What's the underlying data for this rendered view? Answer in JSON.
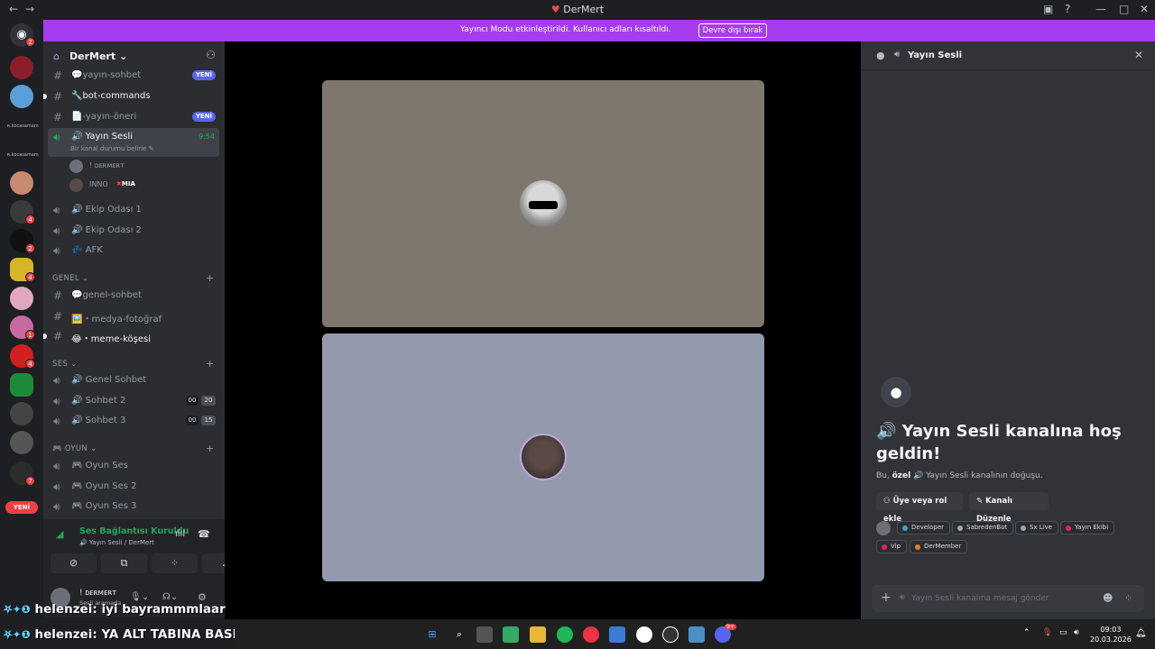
{
  "window": {
    "title": "DerMert",
    "back_icon": "←",
    "forward_icon": "→"
  },
  "banner": {
    "message": "Yayıncı Modu etkinleştirildi. Kullanıcı adları kısaltıldı.",
    "button": "Devre dışı bırak"
  },
  "guild_bar": {
    "home_badge": "2",
    "badges": [
      "4",
      "2",
      "4",
      "1",
      "4",
      "2",
      "1",
      "7"
    ],
    "text_items": [
      "ʀ.kocasamam",
      "ʀ.kocasamam"
    ],
    "new_pill": "YENİ"
  },
  "server": {
    "name": "DerMert"
  },
  "channels": {
    "text_top": [
      {
        "name": "💬yayın-sohbet",
        "tag": "YENİ"
      },
      {
        "name": "🔧bot-commands"
      },
      {
        "name": "📄-yayın-öneri",
        "tag": "YENİ"
      }
    ],
    "active_voice": {
      "name": "🔊 Yayın Sesli",
      "timer": "9:54",
      "status": "Bir kanal durumu belirle"
    },
    "voice_users": [
      {
        "name": "! ᴅᴇʀᴍᴇʀᴛ"
      },
      {
        "name": "INNO",
        "tag": "MIA"
      }
    ],
    "voice_more": [
      {
        "name": "🔊 Ekip Odası 1"
      },
      {
        "name": "🔊 Ekip Odası 2"
      },
      {
        "name": "💤 AFK"
      }
    ],
    "categories": [
      {
        "name": "GENEL",
        "items": [
          {
            "name": "💬genel-sohbet"
          },
          {
            "name": "🖼️・medya-fotoğraf"
          },
          {
            "name": "😂・meme-köşesi"
          }
        ]
      },
      {
        "name": "SES",
        "items": [
          {
            "name": "🔊 Genel Sohbet"
          },
          {
            "name": "🔊 Sohbet 2",
            "c1": "00",
            "c2": "20"
          },
          {
            "name": "🔊 Sohbet 3",
            "c1": "00",
            "c2": "15"
          }
        ]
      },
      {
        "name": "🎮 OYUN",
        "items": [
          {
            "name": "🎮 Oyun Ses"
          },
          {
            "name": "🎮 Oyun Ses 2"
          },
          {
            "name": "🎮 Oyun Ses 3"
          }
        ]
      }
    ]
  },
  "voice_panel": {
    "status": "Ses Bağlantısı Kuruldu",
    "channel": "🔊 Yayın Sesli / DerMert"
  },
  "user": {
    "name": "! ᴅᴇʀᴍᴇʀᴛ",
    "status": "Sesli aramada"
  },
  "right_panel": {
    "title": "Yayın Sesli",
    "welcome_title": "🔊 Yayın Sesli kanalına hoş geldin!",
    "welcome_sub_prefix": "Bu, ",
    "welcome_sub_bold": "özel",
    "welcome_sub_suffix": " 🔊 Yayın Sesli kanalının doğuşu.",
    "buttons": [
      "Üye veya rol ekle",
      "Kanalı Düzenle"
    ],
    "roles": [
      {
        "name": "Developer",
        "color": "#3ba0d6"
      },
      {
        "name": "SabredenBot",
        "color": "#99aab5"
      },
      {
        "name": "Sx Live",
        "color": "#99aab5"
      },
      {
        "name": "Yayın Ekibi",
        "color": "#e91e63"
      },
      {
        "name": "Vip",
        "color": "#e91e63"
      },
      {
        "name": "DerMember",
        "color": "#e67e22"
      }
    ],
    "composer_placeholder": "Yayın Sesli kanalına mesaj gönder"
  },
  "stream_overlay": [
    {
      "badges": "⛧✦❶",
      "user": "helenzei",
      "text": ": iyi bayrammmlaar"
    },
    {
      "badges": "⛧✦❶",
      "user": "helenzei",
      "text": ": YA ALT TABINA BASLATMA İNNO"
    }
  ],
  "taskbar": {
    "time": "09:03",
    "date": "20.03.2026",
    "discord_badge": "9+"
  },
  "colors": {
    "accent": "#a53cf0",
    "voice_green": "#23a55a",
    "blurple": "#5865f2",
    "danger": "#f23f43"
  }
}
